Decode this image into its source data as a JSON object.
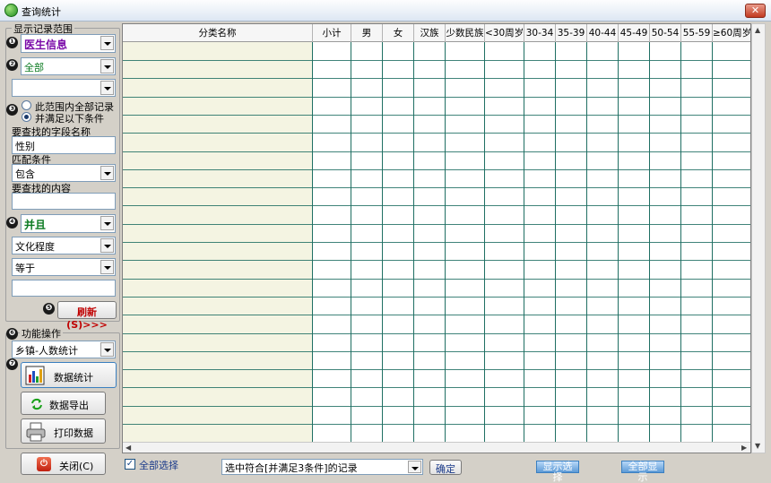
{
  "window": {
    "title": "查询统计",
    "close_glyph": "✕"
  },
  "scope": {
    "group_label": "显示记录范围",
    "badges": [
      "❶",
      "❷",
      "❸",
      "❹",
      "❺",
      "❻",
      "❼"
    ],
    "dataset": "医生信息",
    "range": "全部",
    "range2": "",
    "radio_all": "此范围内全部记录",
    "radio_cond": "并满足以下条件",
    "field_label": "要查找的字段名称",
    "field_value": "性别",
    "match_label": "匹配条件",
    "match_value": "包含",
    "content_label": "要查找的内容",
    "content_value": "",
    "logic_value": "并且",
    "field2_value": "文化程度",
    "match2_value": "等于",
    "content2_value": "",
    "refresh_label": "刷新(S)>>>"
  },
  "ops": {
    "group_label": "功能操作",
    "func_value": "乡镇-人数统计",
    "stats_label": "数据统计",
    "export_label": "数据导出",
    "print_label": "打印数据"
  },
  "grid": {
    "columns": [
      "分类名称",
      "小计",
      "男",
      "女",
      "汉族",
      "少数民族",
      "<30周岁",
      "30-34",
      "35-39",
      "40-44",
      "45-49",
      "50-54",
      "55-59",
      "≥60周岁"
    ]
  },
  "bottom": {
    "close_label": "关闭(C)",
    "select_all_label": "全部选择",
    "select_all_checked": "✓",
    "filter_value": "选中符合[并满足3条件]的记录",
    "confirm_label": "确定",
    "show_selected": "显示选择",
    "show_all": "全部显示"
  },
  "colors": {
    "grid_line": "#1f6f63",
    "badge": "#1a1a1a",
    "link": "#5c9ad6",
    "refresh_text": "#c00000"
  }
}
